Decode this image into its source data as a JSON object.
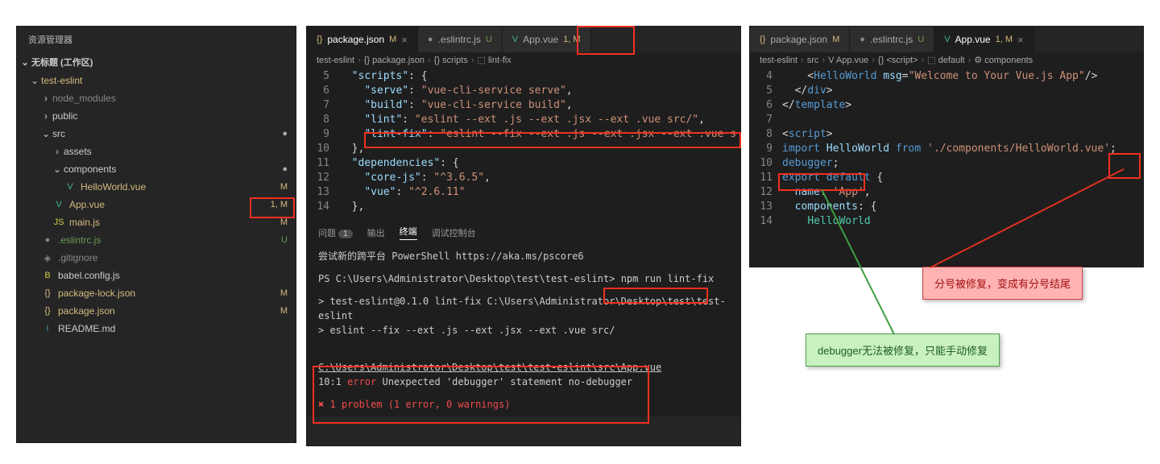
{
  "explorer": {
    "title": "资源管理器",
    "section": "无标题 (工作区)",
    "tree": [
      {
        "name": "test-eslint",
        "chev": "⌄",
        "depth": 0
      },
      {
        "name": "node_modules",
        "chev": "›",
        "depth": 1,
        "dim": true
      },
      {
        "name": "public",
        "chev": "›",
        "depth": 1
      },
      {
        "name": "src",
        "chev": "⌄",
        "depth": 1,
        "badge": "●"
      },
      {
        "name": "assets",
        "chev": "›",
        "depth": 2
      },
      {
        "name": "components",
        "chev": "⌄",
        "depth": 2,
        "badge": "●"
      },
      {
        "name": "HelloWorld.vue",
        "ico": "V",
        "icoc": "vue-ico",
        "depth": 3,
        "badge": "M",
        "m": true
      },
      {
        "name": "App.vue",
        "ico": "V",
        "icoc": "vue-ico",
        "depth": 2,
        "badge": "1, M",
        "m": true,
        "hl": true
      },
      {
        "name": "main.js",
        "ico": "JS",
        "icoc": "js-ico",
        "depth": 2,
        "badge": "M",
        "m": true
      },
      {
        "name": ".eslintrc.js",
        "ico": "●",
        "icoc": "git-ico",
        "depth": 1,
        "badge": "U",
        "u": true
      },
      {
        "name": ".gitignore",
        "ico": "◈",
        "icoc": "git-ico",
        "depth": 1,
        "dim": true
      },
      {
        "name": "babel.config.js",
        "ico": "B",
        "icoc": "js-ico",
        "depth": 1
      },
      {
        "name": "package-lock.json",
        "ico": "{}",
        "icoc": "json-ico",
        "depth": 1,
        "badge": "M",
        "m": true
      },
      {
        "name": "package.json",
        "ico": "{}",
        "icoc": "json-ico",
        "depth": 1,
        "badge": "M",
        "m": true
      },
      {
        "name": "README.md",
        "ico": "i",
        "icoc": "md-ico",
        "depth": 1
      }
    ]
  },
  "midTabs": [
    {
      "ico": "{}",
      "icoc": "json-ico",
      "label": "package.json",
      "flag": "M",
      "flagc": "mflag",
      "active": true,
      "close": "×"
    },
    {
      "ico": "●",
      "icoc": "git-ico",
      "label": ".eslintrc.js",
      "flag": "U",
      "flagc": "uflag"
    },
    {
      "ico": "V",
      "icoc": "vue-ico",
      "label": "App.vue",
      "flag": "1, M",
      "flagc": "mflag"
    }
  ],
  "midCrumb": [
    "test-eslint",
    "{} package.json",
    "{} scripts",
    "⬚ lint-fix"
  ],
  "codeMid": [
    {
      "n": 5,
      "html": "  <span class='s-key'>\"scripts\"</span>: {"
    },
    {
      "n": 6,
      "html": "    <span class='s-key'>\"serve\"</span>: <span class='s-str'>\"vue-cli-service serve\"</span>,"
    },
    {
      "n": 7,
      "html": "    <span class='s-key'>\"build\"</span>: <span class='s-str'>\"vue-cli-service build\"</span>,"
    },
    {
      "n": 8,
      "html": "    <span class='s-key'>\"lint\"</span>: <span class='s-str'>\"eslint --ext .js --ext .jsx --ext .vue src/\"</span>,"
    },
    {
      "n": 9,
      "html": "    <span class='s-key'>\"lint-fix\"</span>: <span class='s-str'>\"eslint --fix --ext .js --ext .jsx --ext .vue s</span>"
    },
    {
      "n": 10,
      "html": "  },"
    },
    {
      "n": 11,
      "html": "  <span class='s-key'>\"dependencies\"</span>: {"
    },
    {
      "n": 12,
      "html": "    <span class='s-key'>\"core-js\"</span>: <span class='s-str'>\"^3.6.5\"</span>,"
    },
    {
      "n": 13,
      "html": "    <span class='s-key'>\"vue\"</span>: <span class='s-str'>\"^2.6.11\"</span>"
    },
    {
      "n": 14,
      "html": "  },"
    }
  ],
  "panelTabs": {
    "problems": "问题",
    "problemsCount": "1",
    "output": "输出",
    "terminal": "终端",
    "debug": "调试控制台"
  },
  "term": {
    "l1": "尝试新的跨平台 PowerShell https://aka.ms/pscore6",
    "l2a": "PS C:\\Users\\Administrator\\Desktop\\test\\test-eslint> ",
    "l2b": "npm run lint-fix",
    "l3": "> test-eslint@0.1.0 lint-fix C:\\Users\\Administrator\\Desktop\\test\\test-eslint",
    "l4": "> eslint --fix --ext .js --ext .jsx --ext .vue src/",
    "l5": "C:\\Users\\Administrator\\Desktop\\test\\test-eslint\\src\\App.vue",
    "l6a": "  10:1  ",
    "l6b": "error",
    "l6c": "  Unexpected 'debugger' statement  no-debugger",
    "l7": "✖ 1 problem (1 error, 0 warnings)"
  },
  "rightTabs": [
    {
      "ico": "{}",
      "icoc": "json-ico",
      "label": "package.json",
      "flag": "M",
      "flagc": "mflag"
    },
    {
      "ico": "●",
      "icoc": "git-ico",
      "label": ".eslintrc.js",
      "flag": "U",
      "flagc": "uflag"
    },
    {
      "ico": "V",
      "icoc": "vue-ico",
      "label": "App.vue",
      "flag": "1, M",
      "flagc": "mflag",
      "active": true,
      "close": "×"
    }
  ],
  "rightCrumb": [
    "test-eslint",
    "src",
    "V App.vue",
    "{} <script>",
    "⬚ default",
    "⚙ components"
  ],
  "codeRight": [
    {
      "n": 4,
      "html": "    &lt;<span class='s-tag'>HelloWorld</span> <span class='s-attr'>msg</span>=<span class='s-str'>\"Welcome to Your Vue.js App\"</span>/&gt;"
    },
    {
      "n": 5,
      "html": "  &lt;/<span class='s-tag'>div</span>&gt;"
    },
    {
      "n": 6,
      "html": "&lt;/<span class='s-tag'>template</span>&gt;"
    },
    {
      "n": 7,
      "html": ""
    },
    {
      "n": 8,
      "html": "&lt;<span class='s-tag'>script</span>&gt;"
    },
    {
      "n": 9,
      "html": "<span class='s-kw'>import</span> <span class='s-var'>HelloWorld</span> <span class='s-kw'>from</span> <span class='s-str'>'./components/HelloWorld.vue'</span>;"
    },
    {
      "n": 10,
      "html": "<span class='s-err'><span class='s-kw'>debugger</span></span>;"
    },
    {
      "n": 11,
      "html": "<span class='s-kw'>export</span> <span class='s-kw'>default</span> {"
    },
    {
      "n": 12,
      "html": "  <span class='s-var'>name</span>: <span class='s-str'>'App'</span>,"
    },
    {
      "n": 13,
      "html": "  <span class='s-var'>components</span>: {"
    },
    {
      "n": 14,
      "html": "    <span class='s-type'>HelloWorld</span>"
    }
  ],
  "callouts": {
    "red": "分号被修复，变成有分号结尾",
    "green": "debugger无法被修复，只能手动修复"
  }
}
